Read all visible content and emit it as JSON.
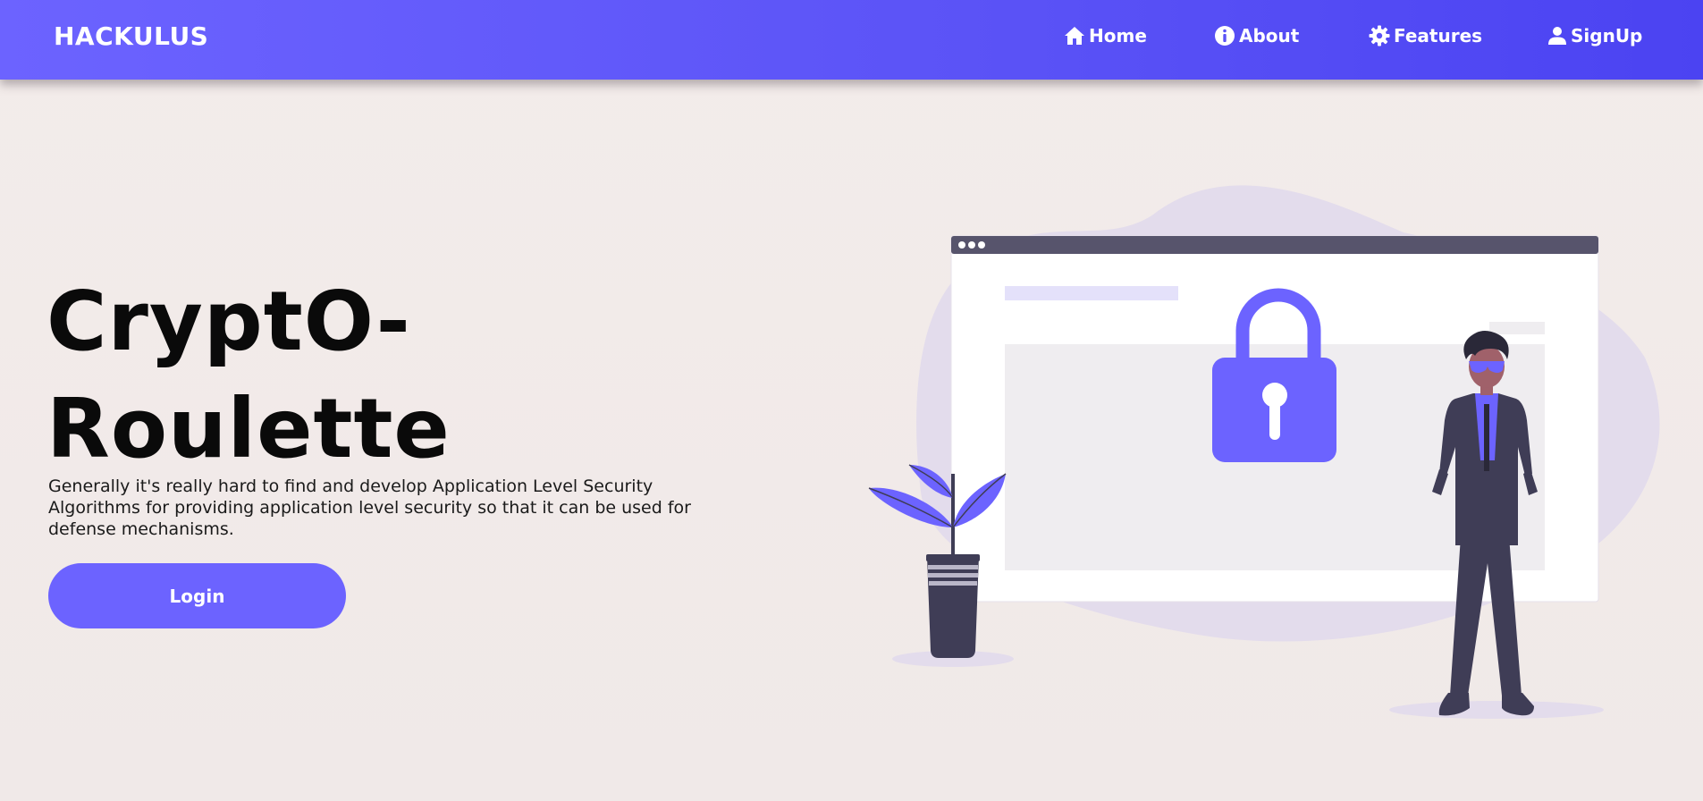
{
  "navbar": {
    "brand": "HACKULUS",
    "items": [
      {
        "label": "Home",
        "icon": "home-icon"
      },
      {
        "label": "About",
        "icon": "info-icon"
      },
      {
        "label": "Features",
        "icon": "gear-icon"
      },
      {
        "label": "SignUp",
        "icon": "user-icon"
      }
    ]
  },
  "hero": {
    "title_line1": "CryptO-",
    "title_line2": "Roulette",
    "description": "Generally it's really hard to find and develop Application Level Security Algorithms for providing application level security so that it can be used for defense mechanisms.",
    "login_label": "Login"
  },
  "colors": {
    "accent": "#6c63ff",
    "navbar_gradient_end": "#4b43f2",
    "background": "#f1ebea",
    "text": "#0a0a0a",
    "figure_dark": "#3f3d56"
  }
}
